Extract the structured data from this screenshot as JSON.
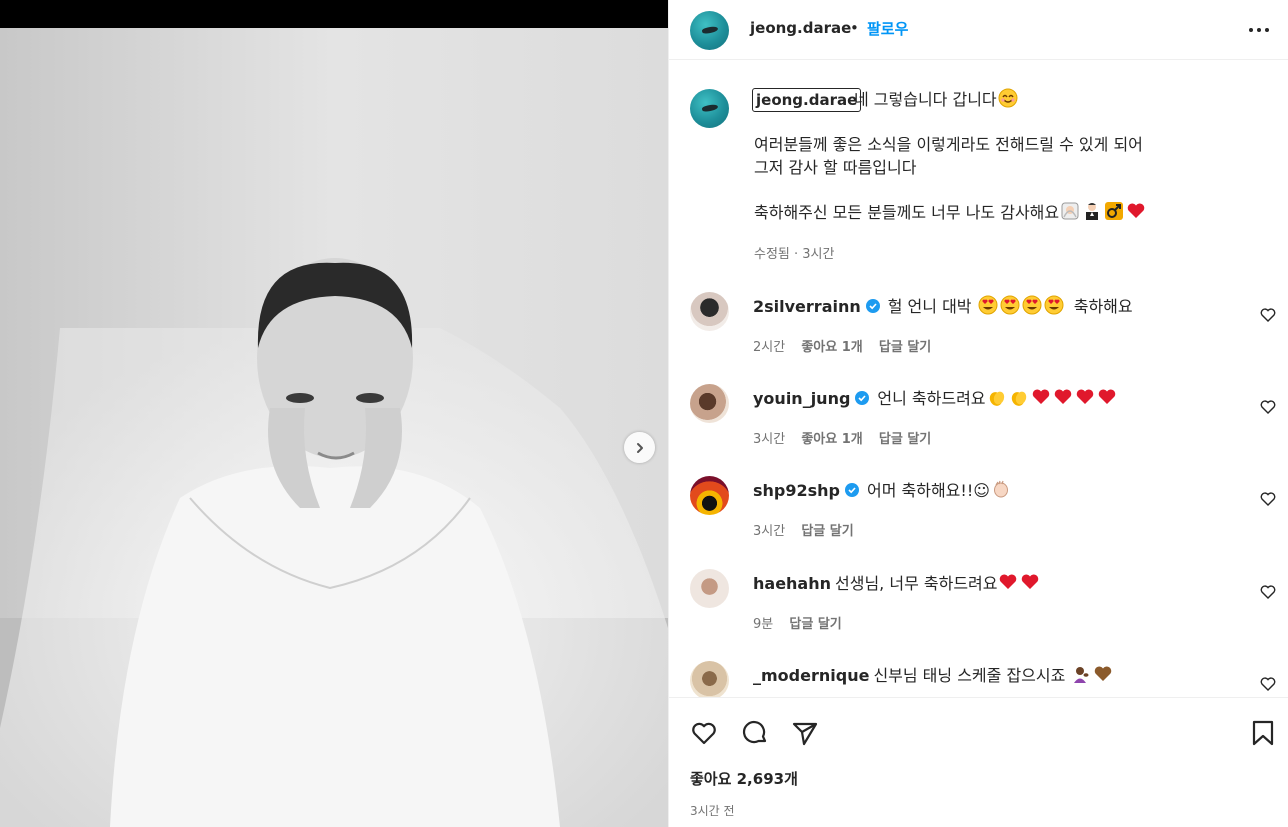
{
  "post": {
    "username": "jeong.darae",
    "follow_label": "팔로우",
    "separator": "•",
    "caption": {
      "line1": "네 그렇습니다 갑니다",
      "line2": "여러분들께 좋은 소식을 이렇게라도 전해드릴 수 있게 되어",
      "line3": "그저 감사 할 따름입니다",
      "line4": "축하해주신 모든 분들께도 너무 나도 감사해요",
      "meta": "수정됨 · 3시간"
    },
    "likes_label": "좋아요 2,693개",
    "time_label": "3시간 전"
  },
  "comments": [
    {
      "user": "2silverrainn",
      "verified": true,
      "text": "헐 언니 대박",
      "suffix": "축하해요",
      "time": "2시간",
      "likes": "좋아요 1개",
      "reply": "답글 달기"
    },
    {
      "user": "youin_jung",
      "verified": true,
      "text": "언니 축하드려요",
      "suffix": "",
      "time": "3시간",
      "likes": "좋아요 1개",
      "reply": "답글 달기"
    },
    {
      "user": "shp92shp",
      "verified": true,
      "text": "어머 축하해요!!☺",
      "suffix": "",
      "time": "3시간",
      "likes": "",
      "reply": "답글 달기"
    },
    {
      "user": "haehahn",
      "verified": false,
      "text": "선생님, 너무 축하드려요",
      "suffix": "",
      "time": "9분",
      "likes": "",
      "reply": "답글 달기"
    },
    {
      "user": "_modernique",
      "verified": false,
      "text": "신부님 태닝 스케줄 잡으시죠",
      "suffix": "",
      "time": "",
      "likes": "",
      "reply": ""
    }
  ],
  "icons": {
    "more": "more-options-icon",
    "next": "chevron-right-icon",
    "like": "heart-icon",
    "comment": "comment-icon",
    "share": "share-icon",
    "save": "bookmark-icon",
    "verified": "verified-badge-icon"
  },
  "colors": {
    "accent": "#0095f6",
    "text": "#262626",
    "muted": "#737373",
    "heart_red": "#e0182c",
    "verified_blue": "#1d9bf0"
  }
}
